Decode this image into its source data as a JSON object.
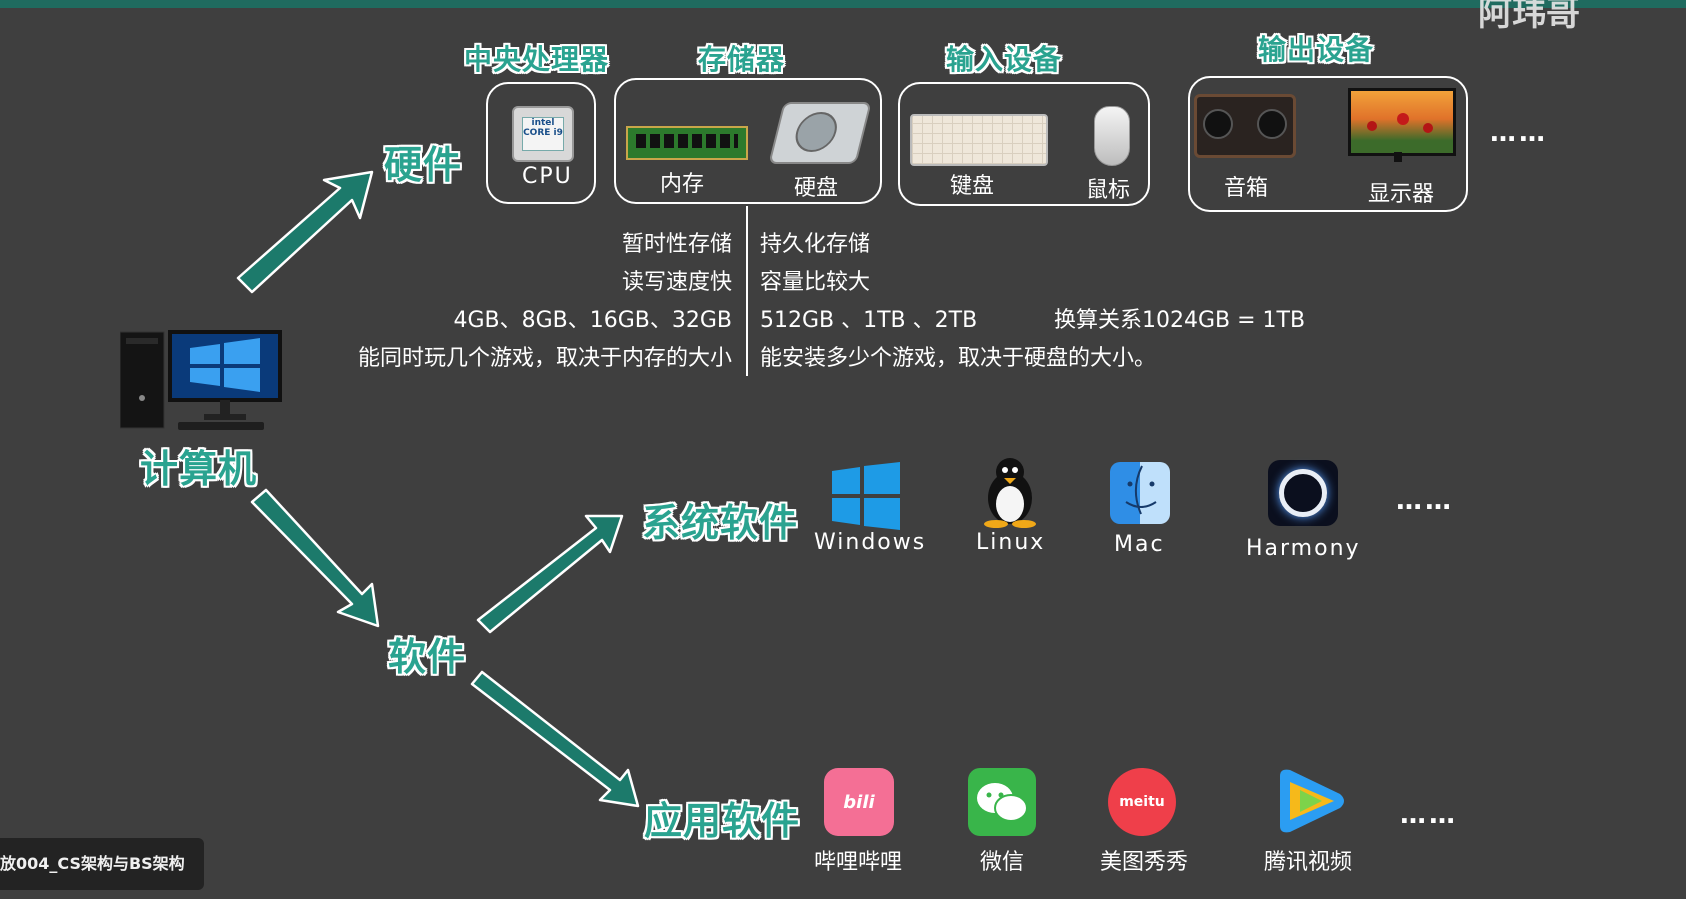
{
  "watermark": "阿玮哥",
  "video_caption": "放004_CS架构与BS架构",
  "root": {
    "label": "计算机"
  },
  "hardware": {
    "label": "硬件",
    "groups": [
      {
        "title": "中央处理器",
        "items": [
          "CPU"
        ]
      },
      {
        "title": "存储器",
        "items": [
          "内存",
          "硬盘"
        ]
      },
      {
        "title": "输入设备",
        "items": [
          "键盘",
          "鼠标"
        ]
      },
      {
        "title": "输出设备",
        "items": [
          "音箱",
          "显示器"
        ]
      }
    ],
    "more": "……"
  },
  "memory_notes": {
    "ram": [
      "暂时性存储",
      "读写速度快",
      "4GB、8GB、16GB、32GB",
      "能同时玩几个游戏，取决于内存的大小"
    ],
    "disk": [
      "持久化存储",
      "容量比较大",
      "512GB 、1TB 、2TB",
      "能安装多少个游戏，取决于硬盘的大小。"
    ],
    "conversion": "换算关系1024GB = 1TB"
  },
  "software": {
    "label": "软件"
  },
  "system_software": {
    "label": "系统软件",
    "items": [
      "Windows",
      "Linux",
      "Mac",
      "Harmony"
    ],
    "more": "……"
  },
  "application_software": {
    "label": "应用软件",
    "items": [
      "哔哩哔哩",
      "微信",
      "美图秀秀",
      "腾讯视频"
    ],
    "more": "……"
  },
  "colors": {
    "accent": "#2aa390",
    "arrow": "#1c7a6b",
    "background": "#3f3f3f"
  }
}
